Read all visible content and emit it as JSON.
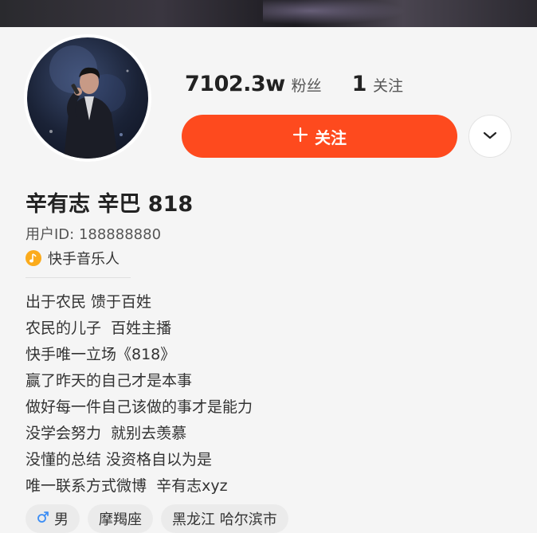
{
  "profile": {
    "name": "辛有志 辛巴 818",
    "user_id": "用户ID: 188888880",
    "badge": "快手音乐人",
    "avatar_icon": "singer-portrait",
    "accent_color": "#fe4a1e"
  },
  "stats": {
    "followers_value": "7102.3w",
    "followers_label": "粉丝",
    "following_value": "1",
    "following_label": "关注"
  },
  "actions": {
    "follow_icon": "plus-icon",
    "follow_label": "关注",
    "more_icon": "chevron-down-icon"
  },
  "bio": [
    "出于农民 馈于百姓",
    "农民的儿子  百姓主播",
    "快手唯一立场《818》",
    "赢了昨天的自己才是本事",
    "做好每一件自己该做的事才是能力",
    "没学会努力  就别去羡慕",
    "没懂的总结 没资格自以为是",
    "唯一联系方式微博  辛有志xyz"
  ],
  "tags": {
    "gender": "男",
    "gender_icon": "male-icon",
    "zodiac": "摩羯座",
    "location": "黑龙江 哈尔滨市"
  }
}
